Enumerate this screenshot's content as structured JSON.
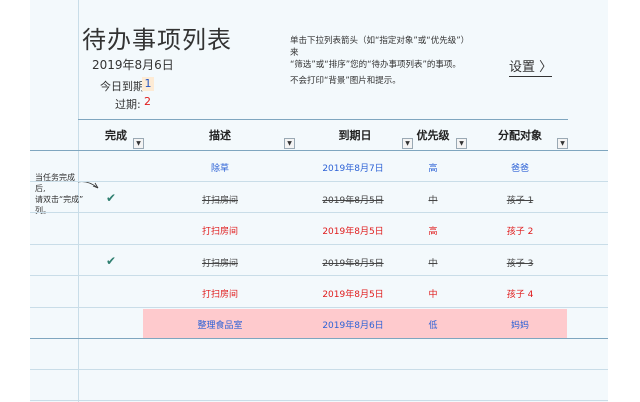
{
  "header": {
    "title": "待办事项列表",
    "date": "2019年8月6日",
    "today_label": "今日到期:",
    "today_count": "1",
    "overdue_label": "过期:",
    "overdue_count": "2"
  },
  "instructions": {
    "line1": "单击下拉列表箭头（如“指定对象”或“优先级”）来",
    "line2": "“筛选”或“排序”您的“待办事项列表”的事项。",
    "line3": "不会打印“背景”图片和提示。"
  },
  "settings_label": "设置 〉",
  "columns": [
    "完成",
    "描述",
    "到期日",
    "优先级",
    "分配对象"
  ],
  "note": {
    "line1": "当任务完成后,",
    "line2": "请双击“完成”",
    "line3": "列。"
  },
  "rows": [
    {
      "done": "",
      "desc": "除草",
      "due": "2019年8月7日",
      "priority": "高",
      "assignee": "爸爸",
      "status": "today"
    },
    {
      "done": "✔",
      "desc": "打扫房间",
      "due": "2019年8月5日",
      "priority": "中",
      "assignee": "孩子 1",
      "status": "done"
    },
    {
      "done": "",
      "desc": "打扫房间",
      "due": "2019年8月5日",
      "priority": "高",
      "assignee": "孩子 2",
      "status": "overdue"
    },
    {
      "done": "✔",
      "desc": "打扫房间",
      "due": "2019年8月5日",
      "priority": "中",
      "assignee": "孩子 3",
      "status": "done"
    },
    {
      "done": "",
      "desc": "打扫房间",
      "due": "2019年8月5日",
      "priority": "中",
      "assignee": "孩子 4",
      "status": "overdue"
    },
    {
      "done": "",
      "desc": "整理食品室",
      "due": "2019年8月6日",
      "priority": "低",
      "assignee": "妈妈",
      "status": "today"
    }
  ],
  "colors": {
    "today": "#2d62d6",
    "overdue": "#e01c1c",
    "done": "#444444",
    "highlight": "#fecacd",
    "check": "#2f7f70"
  }
}
